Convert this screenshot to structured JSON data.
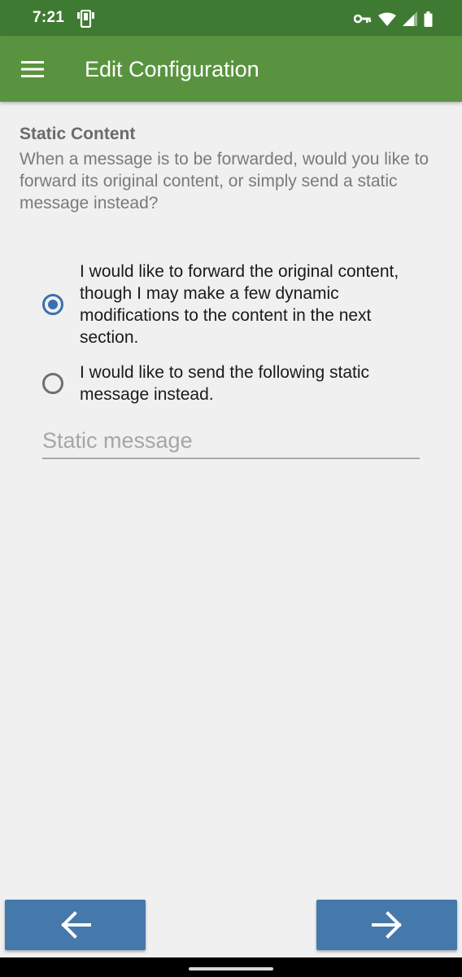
{
  "status_bar": {
    "time": "7:21",
    "icons": [
      "device-icon",
      "vpn-key-icon",
      "wifi-icon",
      "signal-icon",
      "battery-icon"
    ]
  },
  "app_bar": {
    "title": "Edit Configuration",
    "menu_icon": "hamburger-menu-icon"
  },
  "section": {
    "title": "Static Content",
    "description": "When a message is to be forwarded, would you like to forward its original content, or simply send a static message instead?"
  },
  "options": [
    {
      "label": "I would like to forward the original content, though I may make a few dynamic modifications to the content in the next section.",
      "checked": true
    },
    {
      "label": "I would like to send the following static message instead.",
      "checked": false
    }
  ],
  "static_message": {
    "placeholder": "Static message",
    "value": ""
  },
  "navigation": {
    "back_icon": "arrow-left-icon",
    "next_icon": "arrow-right-icon"
  },
  "colors": {
    "status_bar": "#3f7a32",
    "app_bar": "#5a9340",
    "accent": "#3a70b0",
    "button": "#4679ab",
    "background": "#f0f0f0"
  }
}
